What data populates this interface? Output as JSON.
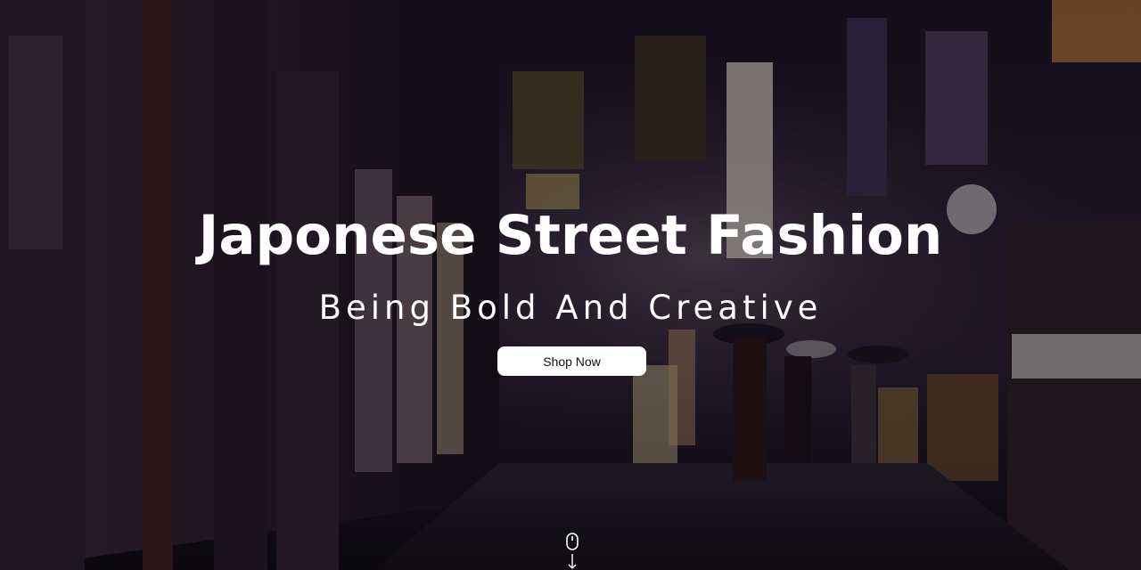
{
  "hero": {
    "title": "Japonese Street Fashion",
    "subtitle": "Being Bold And Creative",
    "cta_label": "Shop Now",
    "scroll_icon": "mouse-scroll-down-icon"
  },
  "colors": {
    "text": "#ffffff",
    "button_bg": "#ffffff",
    "button_text": "#111111"
  }
}
